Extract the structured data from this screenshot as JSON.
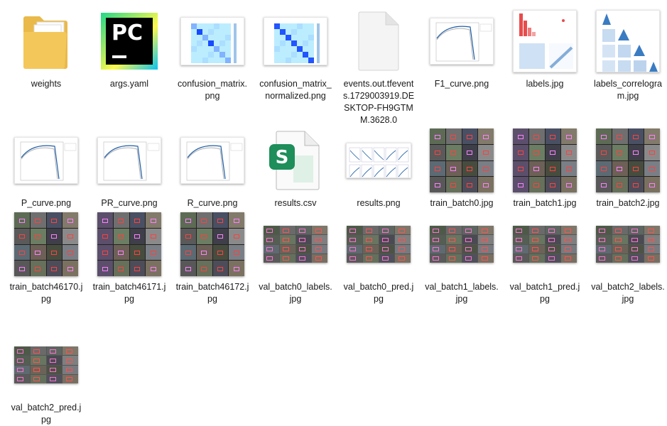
{
  "files": [
    {
      "name": "weights",
      "kind": "folder"
    },
    {
      "name": "args.yaml",
      "kind": "pycharm"
    },
    {
      "name": "confusion_matrix.png",
      "kind": "confusion"
    },
    {
      "name": "confusion_matrix_normalized.png",
      "kind": "confusion-norm"
    },
    {
      "name": "events.out.tfevents.1729003919.DESKTOP-FH9GTMM.3628.0",
      "kind": "blank"
    },
    {
      "name": "F1_curve.png",
      "kind": "curve"
    },
    {
      "name": "labels.jpg",
      "kind": "labels"
    },
    {
      "name": "labels_correlogram.jpg",
      "kind": "correlogram"
    },
    {
      "name": "P_curve.png",
      "kind": "curve"
    },
    {
      "name": "PR_curve.png",
      "kind": "curve"
    },
    {
      "name": "R_curve.png",
      "kind": "curve"
    },
    {
      "name": "results.csv",
      "kind": "csv"
    },
    {
      "name": "results.png",
      "kind": "results"
    },
    {
      "name": "train_batch0.jpg",
      "kind": "batch"
    },
    {
      "name": "train_batch1.jpg",
      "kind": "batch"
    },
    {
      "name": "train_batch2.jpg",
      "kind": "batch"
    },
    {
      "name": "train_batch46170.jpg",
      "kind": "batch"
    },
    {
      "name": "train_batch46171.jpg",
      "kind": "batch"
    },
    {
      "name": "train_batch46172.jpg",
      "kind": "batch"
    },
    {
      "name": "val_batch0_labels.jpg",
      "kind": "val"
    },
    {
      "name": "val_batch0_pred.jpg",
      "kind": "val"
    },
    {
      "name": "val_batch1_labels.jpg",
      "kind": "val"
    },
    {
      "name": "val_batch1_pred.jpg",
      "kind": "val"
    },
    {
      "name": "val_batch2_labels.jpg",
      "kind": "val"
    },
    {
      "name": "val_batch2_pred.jpg",
      "kind": "val"
    }
  ],
  "colors": {
    "folder": "#f3c75a",
    "pycharm_bg": "#000000",
    "pycharm_border": "#21d789",
    "chart_blue": "#1f5fa8",
    "excel_green": "#1e8e5a"
  }
}
